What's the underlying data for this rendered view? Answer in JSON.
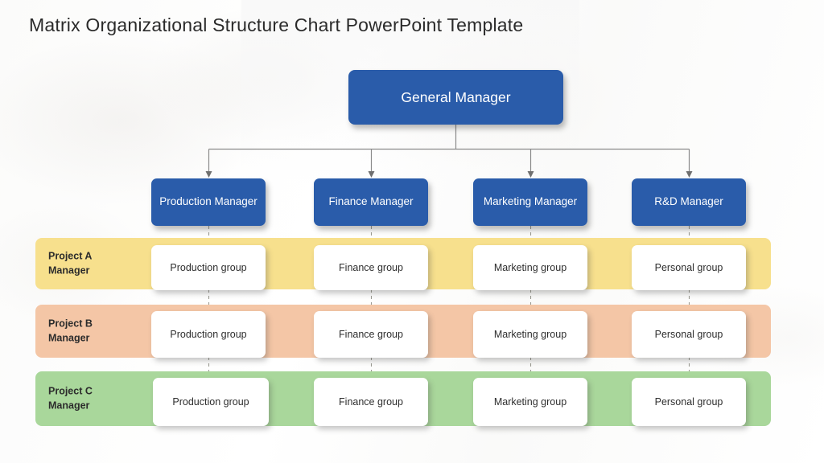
{
  "slide": {
    "title": "Matrix Organizational  Structure Chart PowerPoint Template",
    "colors": {
      "box_blue": "#2a5caa",
      "band_yellow": "#f7e08d",
      "band_peach": "#f4c6a6",
      "band_green": "#a9d79b",
      "card_white": "#ffffff",
      "connector": "#8a8a8a",
      "title_text": "#2b2b2b"
    }
  },
  "top": {
    "label": "General Manager"
  },
  "managers": [
    {
      "label": "Production Manager"
    },
    {
      "label": "Finance Manager"
    },
    {
      "label": "Marketing Manager"
    },
    {
      "label": "R&D Manager"
    }
  ],
  "rows": [
    {
      "label": "Project A\nManager",
      "color": "#f7e08d",
      "cells": [
        {
          "label": "Production group"
        },
        {
          "label": "Finance group"
        },
        {
          "label": "Marketing group"
        },
        {
          "label": "Personal group"
        }
      ]
    },
    {
      "label": "Project B\nManager",
      "color": "#f4c6a6",
      "cells": [
        {
          "label": "Production group"
        },
        {
          "label": "Finance group"
        },
        {
          "label": "Marketing group"
        },
        {
          "label": "Personal group"
        }
      ]
    },
    {
      "label": "Project C\nManager",
      "color": "#a9d79b",
      "cells": [
        {
          "label": "Production group"
        },
        {
          "label": "Finance group"
        },
        {
          "label": "Marketing group"
        },
        {
          "label": "Personal group"
        }
      ]
    }
  ]
}
